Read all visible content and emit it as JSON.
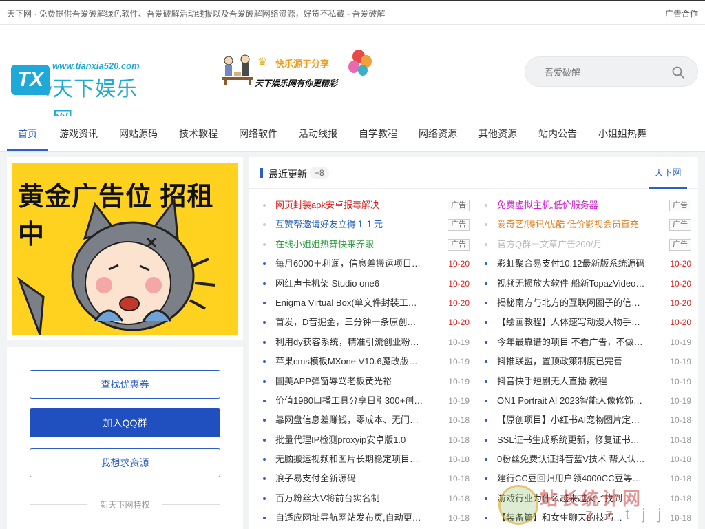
{
  "topbar": {
    "tagline": "天下网 · 免费提供吾爱破解绿色软件、吾爱破解活动线报以及吾爱破解网络资源，好货不私藏 - 吾爱破解",
    "ad_link": "广告合作"
  },
  "logo": {
    "mark": "TX",
    "url": "www.tianxia520.com",
    "name": "天下娱乐网"
  },
  "banner": {
    "slogan_top": "快乐源于分享",
    "slogan_bottom": "天下娱乐网有你更精彩"
  },
  "search": {
    "placeholder": "吾爱破解"
  },
  "nav": {
    "items": [
      "首页",
      "游戏资讯",
      "网站源码",
      "技术教程",
      "网络软件",
      "活动线报",
      "自学教程",
      "网络资源",
      "其他资源",
      "站内公告",
      "小姐姐热舞"
    ],
    "active_index": 0
  },
  "ad_panel": {
    "headline": "黄金广告位 招租中"
  },
  "side": {
    "btn_coupon": "查找优惠券",
    "btn_qq": "加入QQ群",
    "btn_request": "我想求资源",
    "section_title": "新天下网特权"
  },
  "main": {
    "title": "最近更新",
    "count": "+8",
    "tab": "天下网",
    "left_list": [
      {
        "text": "网页封装apk安卓报毒解决",
        "tag": "广告",
        "color": "#e02020"
      },
      {
        "text": "互赞帮邀请好友立得１１元",
        "tag": "广告",
        "color": "#2060c0"
      },
      {
        "text": "在线小姐姐热舞快来养眼",
        "tag": "广告",
        "color": "#30a040"
      },
      {
        "text": "每月6000＋利润，信息差搬运项目，看…",
        "date": "10-20",
        "new": true
      },
      {
        "text": "网红声卡机架 Studio one6",
        "date": "10-20",
        "new": true
      },
      {
        "text": "Enigma Virtual Box(单文件封装工具)…",
        "date": "10-20",
        "new": true
      },
      {
        "text": "首发，D音掘金，三分钟一条原创视频…",
        "date": "10-20",
        "new": true
      },
      {
        "text": "利用dy获客系统，精准引流创业粉、…",
        "date": "10-19"
      },
      {
        "text": "苹果cms模板MXone V10.6魔改版短剧…",
        "date": "10-19"
      },
      {
        "text": "国美APP弹窗辱骂老板黄光裕",
        "date": "10-19"
      },
      {
        "text": "价值1980口播工具分享日引300+创业…",
        "date": "10-19"
      },
      {
        "text": "靠网盘信息差赚钱，零成本、无门槛…",
        "date": "10-18"
      },
      {
        "text": "批量代理IP检测proxyip安卓版1.0",
        "date": "10-18"
      },
      {
        "text": "无脑搬运视频和图片长期稳定项目，…",
        "date": "10-18"
      },
      {
        "text": "浪子易支付全新源码",
        "date": "10-18"
      },
      {
        "text": "百万粉丝大V将前台实名制",
        "date": "10-18"
      },
      {
        "text": "自适应网址导航网站发布页,自动更换…",
        "date": "10-18"
      }
    ],
    "right_list": [
      {
        "text": "免费虚拟主机,低价服务器",
        "tag": "广告",
        "color": "#d020d0"
      },
      {
        "text": "爱奇艺/腾讯/优酷 低价影视会员直充",
        "tag": "广告",
        "color": "#e08020"
      },
      {
        "text": "官方Q群－文章广告200/月",
        "tag": "广告",
        "color": "#bbbbbb"
      },
      {
        "text": "彩虹聚合易支付10.12最新版系统源码",
        "date": "10-20",
        "new": true
      },
      {
        "text": "视频无损放大软件 船新TopazVideo AI…",
        "date": "10-20",
        "new": true
      },
      {
        "text": "揭秘南方与北方的互联网圈子的信息差",
        "date": "10-20",
        "new": true
      },
      {
        "text": "【绘画教程】人体速写动漫人物手绘…",
        "date": "10-20",
        "new": true
      },
      {
        "text": "今年最靠谱的项目 不看广告，不做任…",
        "date": "10-19"
      },
      {
        "text": "抖推联盟，置顶政策制度已完善",
        "date": "10-19"
      },
      {
        "text": "抖音快手短剧无人直播 教程",
        "date": "10-19"
      },
      {
        "text": "ON1 Portrait AI 2023智能人像修饰软…",
        "date": "10-19"
      },
      {
        "text": "【原创项目】小红书AI宠物图片定制…",
        "date": "10-18"
      },
      {
        "text": "SSL证书生成系统更新，修复证书申请…",
        "date": "10-18"
      },
      {
        "text": "0粉丝免费认证抖音蓝V技术 帮人认证…",
        "date": "10-18"
      },
      {
        "text": "建行CC豆回归用户领4000CC豆等于…",
        "date": "10-18"
      },
      {
        "text": "游戏行业为什么越来越火了找到…",
        "date": "10-18"
      },
      {
        "text": "【装备篇】和女生聊天的技巧…",
        "date": "10-18"
      }
    ]
  },
  "watermark": {
    "text": "站长统计网",
    "sub": "z z t j j . c n"
  }
}
